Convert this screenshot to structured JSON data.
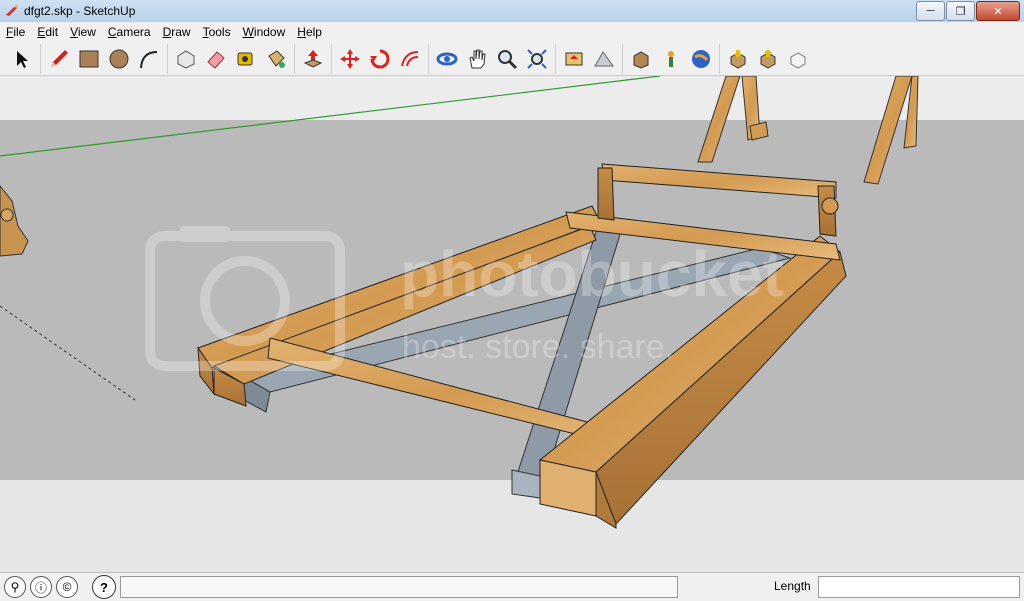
{
  "window": {
    "title": "dfgt2.skp - SketchUp",
    "minimize_icon": "minimize-icon",
    "maximize_icon": "restore-icon",
    "close_icon": "close-icon"
  },
  "menu": [
    {
      "label": "File"
    },
    {
      "label": "Edit"
    },
    {
      "label": "View"
    },
    {
      "label": "Camera"
    },
    {
      "label": "Draw"
    },
    {
      "label": "Tools"
    },
    {
      "label": "Window"
    },
    {
      "label": "Help"
    }
  ],
  "toolbar": {
    "tools": [
      "select-icon",
      "pencil-icon",
      "rectangle-icon",
      "circle-icon",
      "arc-icon",
      "make-component-icon",
      "eraser-icon",
      "tape-measure-icon",
      "paint-bucket-icon",
      "push-pull-icon",
      "move-icon",
      "rotate-icon",
      "offset-icon",
      "orbit-icon",
      "pan-icon",
      "zoom-icon",
      "zoom-extents-icon",
      "add-location-icon",
      "toggle-terrain-icon",
      "get-models-icon",
      "share-model-icon",
      "share-component-icon",
      "get-component-icon",
      "google-earth-icon",
      "export-icon",
      "import-icon",
      "preview-icon"
    ]
  },
  "watermark": {
    "brand": "photobucket",
    "tagline": "host. store. share."
  },
  "status": {
    "length_label": "Length",
    "measure_value": ""
  },
  "colors": {
    "wood": "#d9a35c",
    "metal": "#8e9aa6",
    "ground": "#b9b9b9",
    "sky": "#e6e6e6",
    "axis_green": "#2c9a2c"
  }
}
